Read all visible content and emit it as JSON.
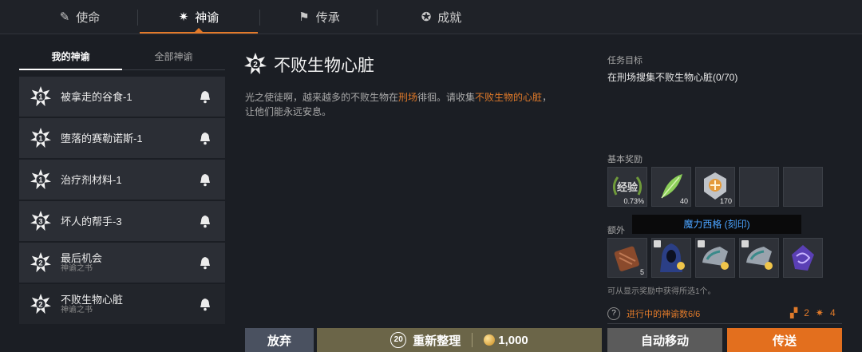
{
  "tabs": [
    {
      "icon": "feather-icon",
      "label": "使命"
    },
    {
      "icon": "oracle-star-icon",
      "label": "神谕"
    },
    {
      "icon": "flag-icon",
      "label": "传承"
    },
    {
      "icon": "medal-icon",
      "label": "成就"
    }
  ],
  "subtabs": {
    "mine": "我的神谕",
    "all": "全部神谕"
  },
  "quests": [
    {
      "num": "1",
      "title": "被拿走的谷食-1",
      "sub": ""
    },
    {
      "num": "1",
      "title": "堕落的赛勒诺斯-1",
      "sub": ""
    },
    {
      "num": "1",
      "title": "治疗剂材料-1",
      "sub": ""
    },
    {
      "num": "3",
      "title": "坏人的帮手-3",
      "sub": ""
    },
    {
      "num": "2",
      "title": "最后机会",
      "sub": "神谕之书"
    },
    {
      "num": "2",
      "title": "不败生物心脏",
      "sub": "神谕之书"
    }
  ],
  "detail": {
    "num": "2",
    "title": "不败生物心脏",
    "desc_a": "光之使徒啊，越来越多的不败生物在",
    "desc_hl1": "刑场",
    "desc_b": "徘徊。请收集",
    "desc_hl2": "不败生物的心脏",
    "desc_c": "，",
    "desc_line2": "让他们能永远安息。"
  },
  "objective": {
    "label": "任务目标",
    "text": "在刑场搜集不败生物心脏(0/70)"
  },
  "rewards": {
    "basic_label": "基本奖励",
    "basic": [
      {
        "name": "exp-icon",
        "text": "经验",
        "qty": "0.73%"
      },
      {
        "name": "leaf-icon",
        "qty": "40"
      },
      {
        "name": "crest-icon",
        "qty": "170"
      },
      {
        "name": "",
        "qty": ""
      },
      {
        "name": "",
        "qty": ""
      }
    ],
    "extra_label": "额外",
    "tooltip": "魔力西格 (刻印)",
    "extra": [
      {
        "name": "scroll-icon",
        "qty": "5"
      },
      {
        "name": "hooded-cloak-icon",
        "qty": ""
      },
      {
        "name": "shoulder-armor-icon",
        "qty": ""
      },
      {
        "name": "shoulder-armor-icon",
        "qty": ""
      },
      {
        "name": "rune-icon",
        "qty": ""
      }
    ],
    "note": "可从显示奖励中获得所选1个。"
  },
  "progress": {
    "help": "?",
    "text": "进行中的神谕数6/6",
    "count1": "2",
    "count2": "4"
  },
  "buttons": {
    "abandon": "放弃",
    "reset_badge": "20",
    "reset": "重新整理",
    "cost": "1,000",
    "auto": "自动移动",
    "send": "传送"
  },
  "colors": {
    "accent": "#e37a2a",
    "highlight": "#e07a2a",
    "link_blue": "#4ba3ff"
  }
}
